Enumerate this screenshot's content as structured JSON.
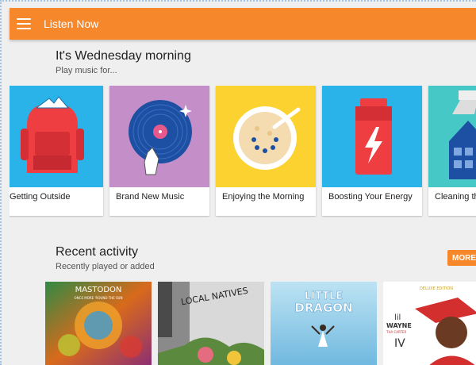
{
  "app_bar": {
    "title": "Listen Now",
    "color": "#f6872a"
  },
  "greeting": {
    "title": "It's Wednesday morning",
    "subtitle": "Play music for..."
  },
  "activity_cards": [
    {
      "label": "Getting Outside",
      "bg": "#29b3e8"
    },
    {
      "label": "Brand New Music",
      "bg": "#c48fc8"
    },
    {
      "label": "Enjoying the Morning",
      "bg": "#fbd22f"
    },
    {
      "label": "Boosting Your Energy",
      "bg": "#29b3e8"
    },
    {
      "label": "Cleaning th",
      "bg": "#46c9c6"
    }
  ],
  "recent": {
    "title": "Recent activity",
    "subtitle": "Recently played or added",
    "more_label": "MORE",
    "albums": [
      {
        "cover_text": "MASTODON",
        "extra": "ONCE MORE 'ROUND THE SUN"
      },
      {
        "cover_text": "LOCAL NATIVES"
      },
      {
        "cover_text_1": "LITTLE",
        "cover_text_2": "DRAGON"
      },
      {
        "banner": "DELUXE EDITION",
        "line1": "lil",
        "line2": "WAYNE",
        "line3": "THA CARTER",
        "line4": "IV"
      }
    ]
  }
}
